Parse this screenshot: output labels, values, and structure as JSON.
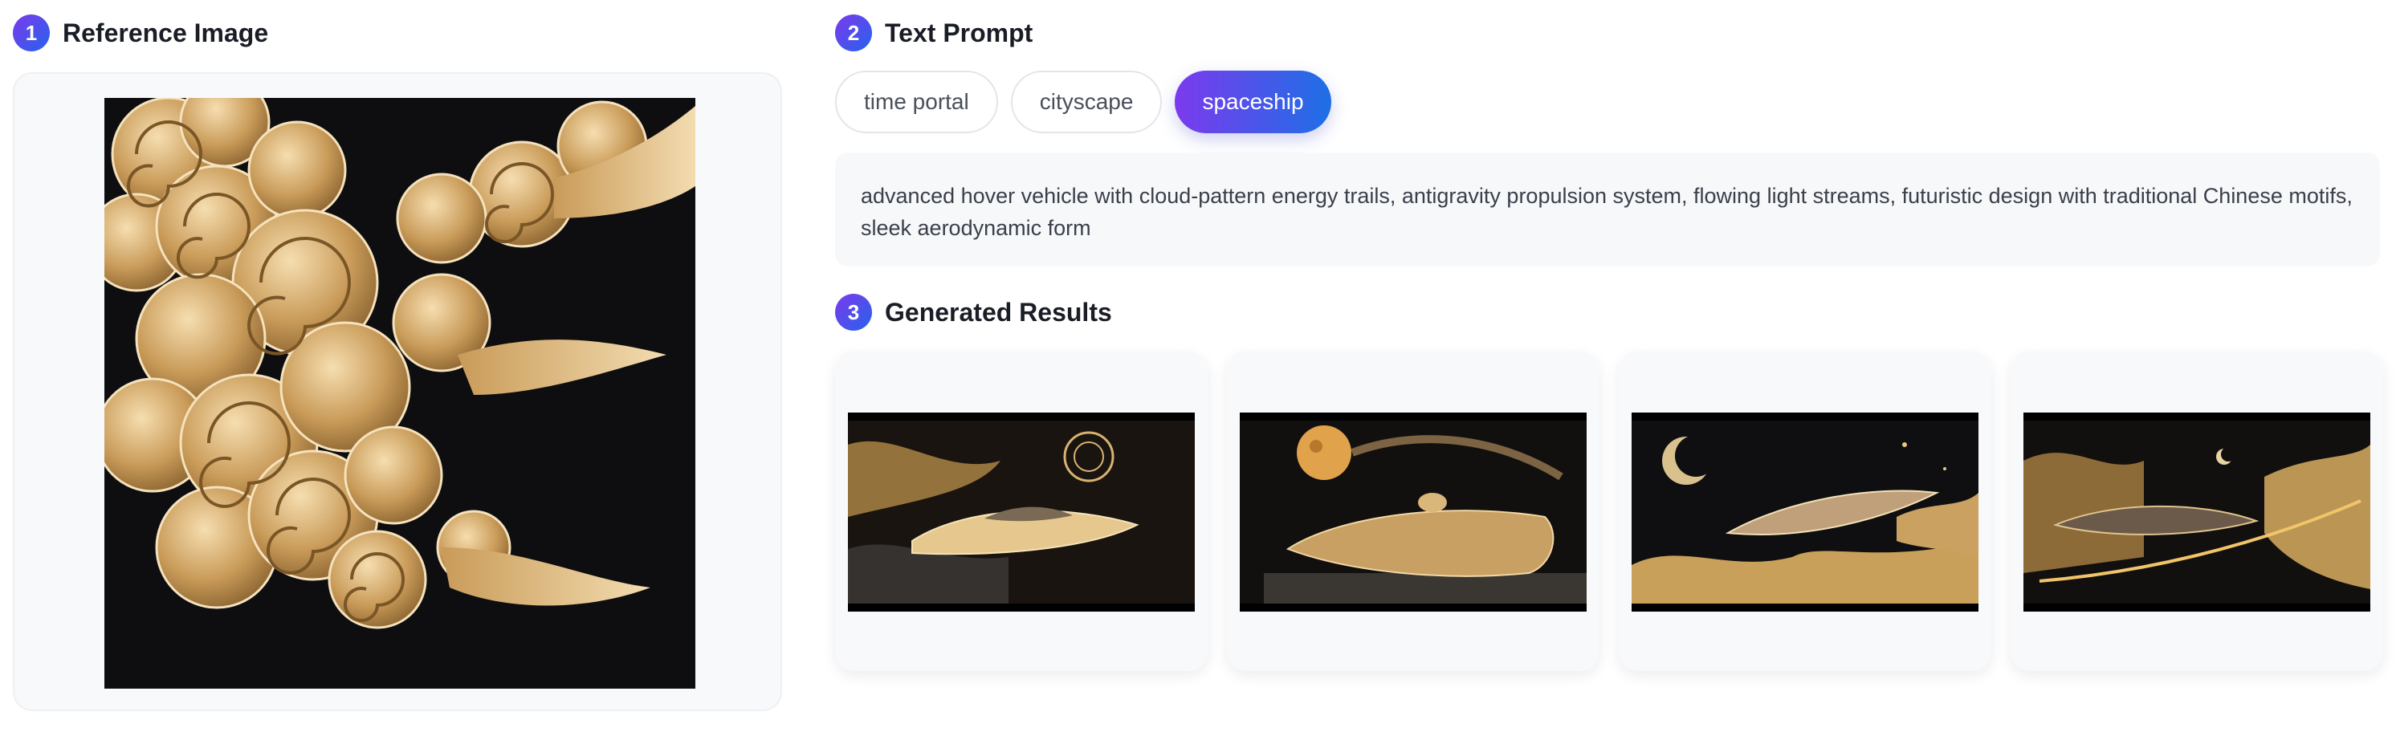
{
  "sections": {
    "reference": {
      "number": "1",
      "title": "Reference Image"
    },
    "prompt": {
      "number": "2",
      "title": "Text Prompt"
    },
    "results": {
      "number": "3",
      "title": "Generated Results"
    }
  },
  "tags": [
    {
      "label": "time portal",
      "active": false
    },
    {
      "label": "cityscape",
      "active": false
    },
    {
      "label": "spaceship",
      "active": true
    }
  ],
  "prompt_text": "advanced hover vehicle with cloud-pattern energy trails, antigravity propulsion system, flowing light streams, futuristic design with traditional Chinese motifs, sleek aerodynamic form",
  "colors": {
    "accent_start": "#7c3aed",
    "accent_end": "#1d6fe6",
    "gold": "#d8b271"
  }
}
